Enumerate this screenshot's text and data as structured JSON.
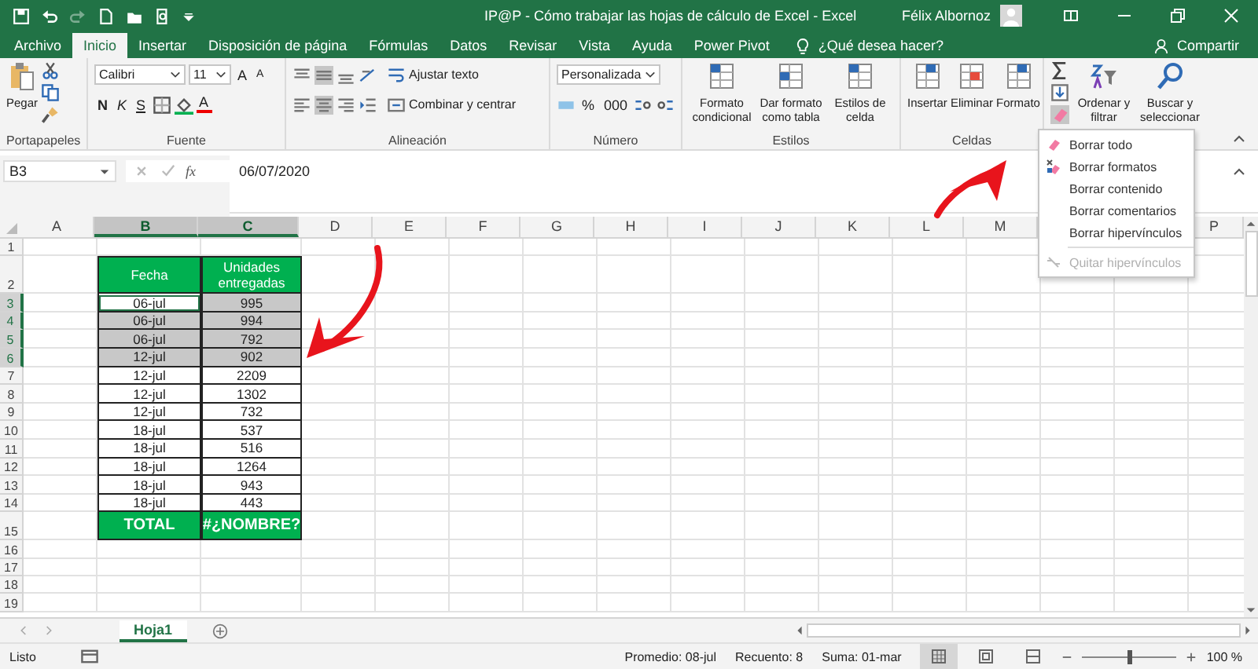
{
  "title_bar": {
    "title": "IP@P - Cómo trabajar las hojas de cálculo de Excel  -  Excel",
    "user": "Félix Albornoz"
  },
  "tabs": [
    {
      "label": "Archivo",
      "selected": false
    },
    {
      "label": "Inicio",
      "selected": true
    },
    {
      "label": "Insertar",
      "selected": false
    },
    {
      "label": "Disposición de página",
      "selected": false
    },
    {
      "label": "Fórmulas",
      "selected": false
    },
    {
      "label": "Datos",
      "selected": false
    },
    {
      "label": "Revisar",
      "selected": false
    },
    {
      "label": "Vista",
      "selected": false
    },
    {
      "label": "Ayuda",
      "selected": false
    },
    {
      "label": "Power Pivot",
      "selected": false
    }
  ],
  "tell_me": "¿Qué desea hacer?",
  "share": "Compartir",
  "ribbon": [
    {
      "kind": "clipboard",
      "label": "Portapapeles",
      "paste": "Pegar"
    },
    {
      "kind": "font",
      "label": "Fuente",
      "font": "Calibri",
      "size": "11",
      "grow": "A",
      "shrink": "A",
      "bold": "N",
      "italic": "K",
      "underline": "S",
      "color_label": "A"
    },
    {
      "kind": "alignment",
      "label": "Alineación",
      "wrap": "Ajustar texto",
      "merge": "Combinar y centrar"
    },
    {
      "kind": "number",
      "label": "Número",
      "format": "Personalizada",
      "percent": "%",
      "thousands": "000"
    },
    {
      "kind": "styles",
      "label": "Estilos",
      "buttons": [
        "Formato condicional",
        "Dar formato como tabla",
        "Estilos de celda"
      ]
    },
    {
      "kind": "cells",
      "label": "Celdas",
      "buttons": [
        "Insertar",
        "Eliminar",
        "Formato"
      ]
    },
    {
      "kind": "editing",
      "buttons": [
        "Ordenar y filtrar",
        "Buscar y seleccionar"
      ]
    }
  ],
  "formula_bar": {
    "name_box": "B3",
    "function_label": "fx",
    "value": "06/07/2020"
  },
  "columns": [
    {
      "label": "A",
      "selected": false
    },
    {
      "label": "B",
      "selected": true
    },
    {
      "label": "C",
      "selected": true
    },
    {
      "label": "D",
      "selected": false
    },
    {
      "label": "E",
      "selected": false
    },
    {
      "label": "F",
      "selected": false
    },
    {
      "label": "G",
      "selected": false
    },
    {
      "label": "H",
      "selected": false
    },
    {
      "label": "I",
      "selected": false
    },
    {
      "label": "J",
      "selected": false
    },
    {
      "label": "K",
      "selected": false
    },
    {
      "label": "L",
      "selected": false
    },
    {
      "label": "M",
      "selected": false
    },
    {},
    {},
    {
      "label": "P",
      "selected": false
    }
  ],
  "rows": [
    {
      "number": "1",
      "kind": "empty",
      "selected": false
    },
    {
      "number": "2",
      "kind": "header",
      "selected": false,
      "cells": [
        "Fecha",
        "Unidades entregadas"
      ]
    },
    {
      "number": "3",
      "kind": "data",
      "selected": true,
      "active": true,
      "cells": [
        "06-jul",
        "995"
      ]
    },
    {
      "number": "4",
      "kind": "data",
      "selected": true,
      "active": false,
      "cells": [
        "06-jul",
        "994"
      ]
    },
    {
      "number": "5",
      "kind": "data",
      "selected": true,
      "active": false,
      "cells": [
        "06-jul",
        "792"
      ]
    },
    {
      "number": "6",
      "kind": "data",
      "selected": true,
      "active": false,
      "cells": [
        "12-jul",
        "902"
      ]
    },
    {
      "number": "7",
      "kind": "data",
      "selected": false,
      "active": false,
      "cells": [
        "12-jul",
        "2209"
      ]
    },
    {
      "number": "8",
      "kind": "data",
      "selected": false,
      "active": false,
      "cells": [
        "12-jul",
        "1302"
      ]
    },
    {
      "number": "9",
      "kind": "data",
      "selected": false,
      "active": false,
      "cells": [
        "12-jul",
        "732"
      ]
    },
    {
      "number": "10",
      "kind": "data",
      "selected": false,
      "active": false,
      "cells": [
        "18-jul",
        "537"
      ]
    },
    {
      "number": "11",
      "kind": "data",
      "selected": false,
      "active": false,
      "cells": [
        "18-jul",
        "516"
      ]
    },
    {
      "number": "12",
      "kind": "data",
      "selected": false,
      "active": false,
      "cells": [
        "18-jul",
        "1264"
      ]
    },
    {
      "number": "13",
      "kind": "data",
      "selected": false,
      "active": false,
      "cells": [
        "18-jul",
        "943"
      ]
    },
    {
      "number": "14",
      "kind": "data",
      "selected": false,
      "active": false,
      "cells": [
        "18-jul",
        "443"
      ]
    },
    {
      "number": "15",
      "kind": "total",
      "selected": false,
      "cells": [
        "TOTAL",
        "#¿NOMBRE?"
      ]
    },
    {
      "number": "16",
      "kind": "empty",
      "selected": false
    },
    {
      "number": "17",
      "kind": "empty",
      "selected": false
    },
    {
      "number": "18",
      "kind": "empty",
      "selected": false
    },
    {
      "number": "19",
      "kind": "empty",
      "selected": false
    }
  ],
  "clear_menu": {
    "sections": [
      [
        {
          "label": "Borrar todo",
          "disabled": false
        },
        {
          "label": "Borrar formatos",
          "disabled": false
        },
        {
          "label": "Borrar contenido",
          "disabled": false
        },
        {
          "label": "Borrar comentarios",
          "disabled": false
        },
        {
          "label": "Borrar hipervínculos",
          "disabled": false
        }
      ],
      [
        {
          "label": "Quitar hipervínculos",
          "disabled": true
        }
      ]
    ]
  },
  "sheet_tabs": [
    {
      "label": "Hoja1",
      "selected": true
    }
  ],
  "status_bar": {
    "status": "Listo",
    "stats": [
      "Promedio: 08-jul",
      "Recuento: 8",
      "Suma: 01-mar"
    ],
    "zoom": {
      "level": 0.5,
      "reading": "100 %"
    }
  }
}
